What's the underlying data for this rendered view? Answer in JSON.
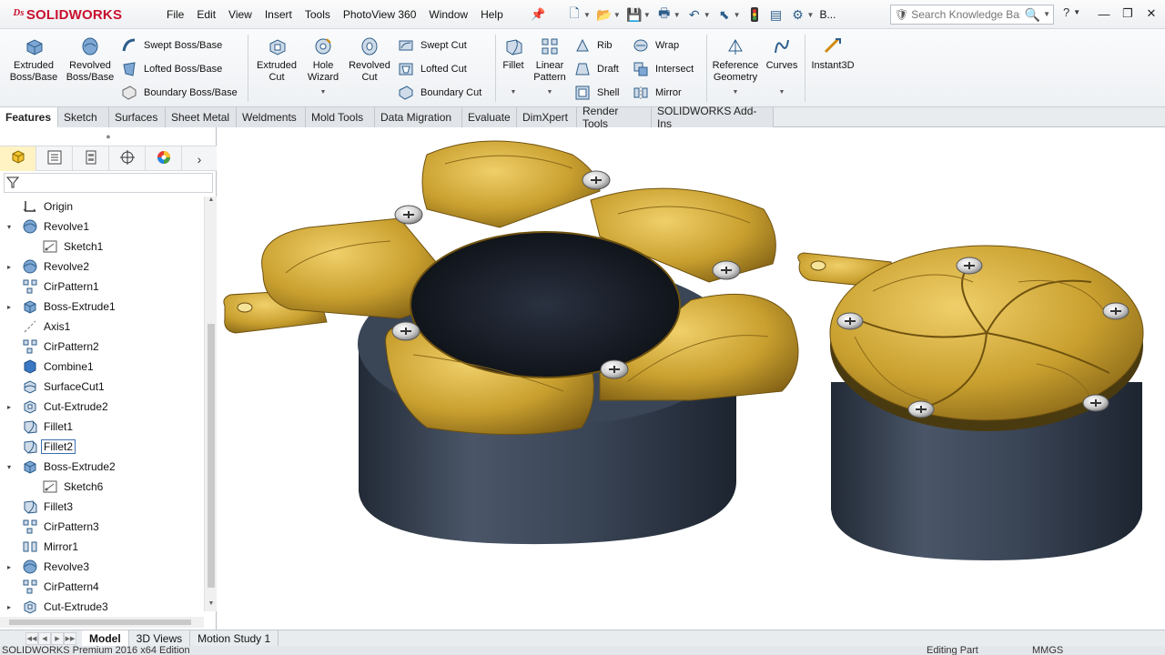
{
  "app": {
    "brand": "SOLIDWORKS",
    "status_text": "SOLIDWORKS Premium 2016 x64 Edition",
    "mode": "Editing Part",
    "units": "MMGS"
  },
  "menubar": {
    "menus": [
      "File",
      "Edit",
      "View",
      "Insert",
      "Tools",
      "PhotoView 360",
      "Window",
      "Help"
    ],
    "search_placeholder": "Search Knowledge Base",
    "truncated_label": "B..."
  },
  "ribbon": {
    "extruded_boss": "Extruded Boss/Base",
    "revolved_boss": "Revolved Boss/Base",
    "swept_boss": "Swept Boss/Base",
    "lofted_boss": "Lofted Boss/Base",
    "boundary_boss": "Boundary Boss/Base",
    "extruded_cut": "Extruded Cut",
    "hole_wizard": "Hole Wizard",
    "revolved_cut": "Revolved Cut",
    "swept_cut": "Swept Cut",
    "lofted_cut": "Lofted Cut",
    "boundary_cut": "Boundary Cut",
    "fillet": "Fillet",
    "linear_pattern": "Linear Pattern",
    "rib": "Rib",
    "draft": "Draft",
    "shell": "Shell",
    "wrap": "Wrap",
    "intersect": "Intersect",
    "mirror": "Mirror",
    "reference_geometry": "Reference Geometry",
    "curves": "Curves",
    "instant3d": "Instant3D"
  },
  "tabs": [
    "Features",
    "Sketch",
    "Surfaces",
    "Sheet Metal",
    "Weldments",
    "Mold Tools",
    "Data Migration",
    "Evaluate",
    "DimXpert",
    "Render Tools",
    "SOLIDWORKS Add-Ins"
  ],
  "active_tab": "Features",
  "tree": [
    {
      "label": "Origin",
      "icon": "origin-icon",
      "expandable": false,
      "indent": 0
    },
    {
      "label": "Revolve1",
      "icon": "revolve-icon",
      "expandable": true,
      "expanded": true,
      "indent": 0
    },
    {
      "label": "Sketch1",
      "icon": "sketch-icon",
      "expandable": false,
      "indent": 1
    },
    {
      "label": "Revolve2",
      "icon": "revolve-icon",
      "expandable": true,
      "expanded": false,
      "indent": 0
    },
    {
      "label": "CirPattern1",
      "icon": "circular-pattern-icon",
      "expandable": false,
      "indent": 0
    },
    {
      "label": "Boss-Extrude1",
      "icon": "extrude-icon",
      "expandable": true,
      "expanded": false,
      "indent": 0
    },
    {
      "label": "Axis1",
      "icon": "axis-icon",
      "expandable": false,
      "indent": 0
    },
    {
      "label": "CirPattern2",
      "icon": "circular-pattern-icon",
      "expandable": false,
      "indent": 0
    },
    {
      "label": "Combine1",
      "icon": "combine-icon",
      "expandable": false,
      "indent": 0
    },
    {
      "label": "SurfaceCut1",
      "icon": "surface-cut-icon",
      "expandable": false,
      "indent": 0
    },
    {
      "label": "Cut-Extrude2",
      "icon": "cut-extrude-icon",
      "expandable": true,
      "expanded": false,
      "indent": 0
    },
    {
      "label": "Fillet1",
      "icon": "fillet-icon",
      "expandable": false,
      "indent": 0
    },
    {
      "label": "Fillet2",
      "icon": "fillet-icon",
      "expandable": false,
      "indent": 0,
      "selected": true
    },
    {
      "label": "Boss-Extrude2",
      "icon": "extrude-icon",
      "expandable": true,
      "expanded": true,
      "indent": 0
    },
    {
      "label": "Sketch6",
      "icon": "sketch-icon",
      "expandable": false,
      "indent": 1
    },
    {
      "label": "Fillet3",
      "icon": "fillet-icon",
      "expandable": false,
      "indent": 0
    },
    {
      "label": "CirPattern3",
      "icon": "circular-pattern-icon",
      "expandable": false,
      "indent": 0
    },
    {
      "label": "Mirror1",
      "icon": "mirror-icon",
      "expandable": false,
      "indent": 0
    },
    {
      "label": "Revolve3",
      "icon": "revolve-icon",
      "expandable": true,
      "expanded": false,
      "indent": 0
    },
    {
      "label": "CirPattern4",
      "icon": "circular-pattern-icon",
      "expandable": false,
      "indent": 0
    },
    {
      "label": "Cut-Extrude3",
      "icon": "cut-extrude-icon",
      "expandable": true,
      "expanded": false,
      "indent": 0
    }
  ],
  "bottom_tabs": [
    "Model",
    "3D Views",
    "Motion Study 1"
  ],
  "active_bottom_tab": "Model",
  "colors": {
    "brand_red": "#c8102e",
    "brass": "#c9a02f",
    "slate": "#3b4656",
    "accent_blue": "#2c5d8a"
  }
}
